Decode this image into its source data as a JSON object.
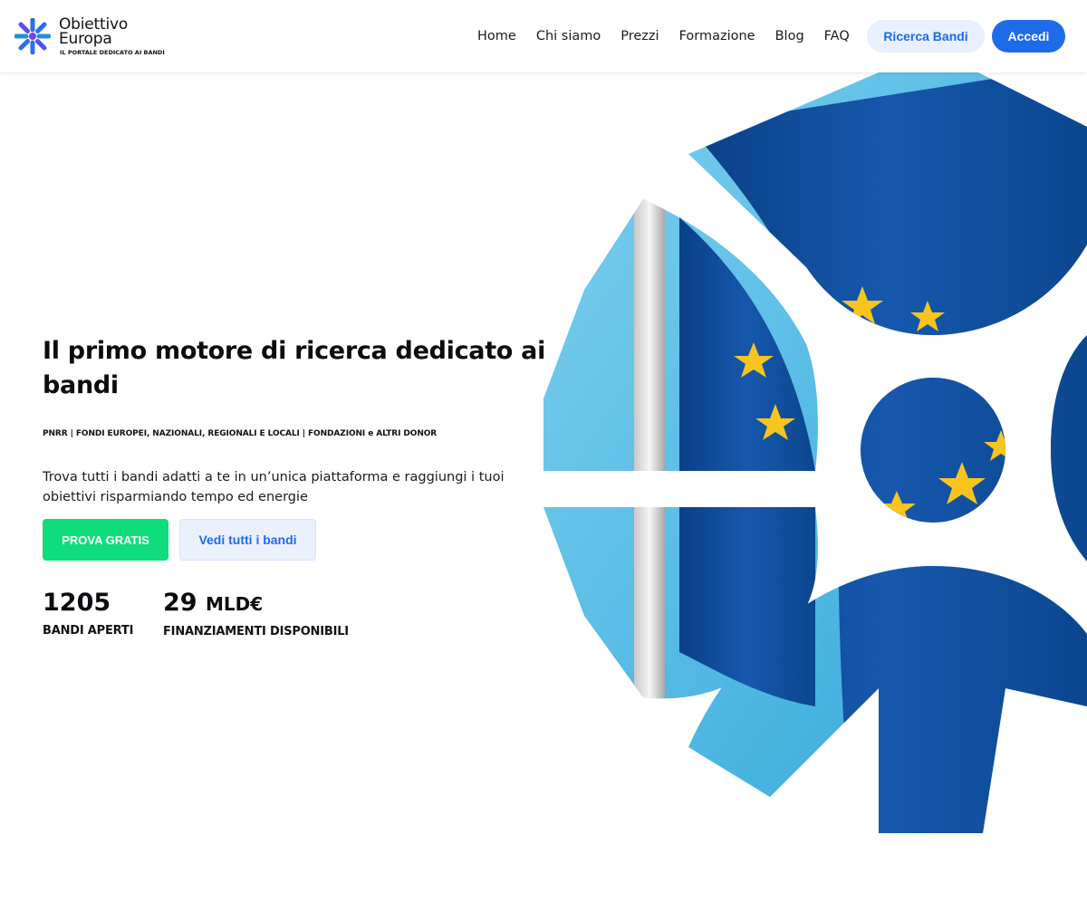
{
  "brand": {
    "name_line1": "Obiettivo",
    "name_line2": "Europa",
    "tagline": "IL PORTALE DEDICATO AI BANDI"
  },
  "nav": {
    "items": [
      {
        "label": "Home"
      },
      {
        "label": "Chi siamo"
      },
      {
        "label": "Prezzi"
      },
      {
        "label": "Formazione"
      },
      {
        "label": "Blog"
      },
      {
        "label": "FAQ"
      }
    ],
    "search_button": "Ricerca Bandi",
    "login_button": "Accedi"
  },
  "hero": {
    "title": "Il primo motore di ricerca dedicato ai bandi",
    "tags": "PNRR | FONDI EUROPEI, NAZIONALI, REGIONALI E LOCALI | FONDAZIONI e ALTRI DONOR",
    "description": "Trova tutti i bandi adatti a te in un’unica piattaforma e raggiungi i tuoi obiettivi risparmiando tempo ed energie",
    "cta_primary": "PROVA GRATIS",
    "cta_secondary": "Vedi tutti i bandi",
    "stats": [
      {
        "value": "1205",
        "unit": "",
        "label": "BANDI APERTI"
      },
      {
        "value": "29",
        "unit": "MLD€",
        "label": "FINANZIAMENTI DISPONIBILI"
      }
    ]
  },
  "colors": {
    "primary_blue": "#1d6be8",
    "light_blue_bg": "#e8f0fd",
    "green_cta": "#0fdc7a",
    "eu_blue": "#0d4a9a",
    "eu_star": "#f7c51e",
    "logo_purple": "#6a3de8"
  },
  "icons": {
    "logo": "snowflake-asterisk-logo",
    "hero_graphic": "eu-flag-asterisk-graphic"
  }
}
